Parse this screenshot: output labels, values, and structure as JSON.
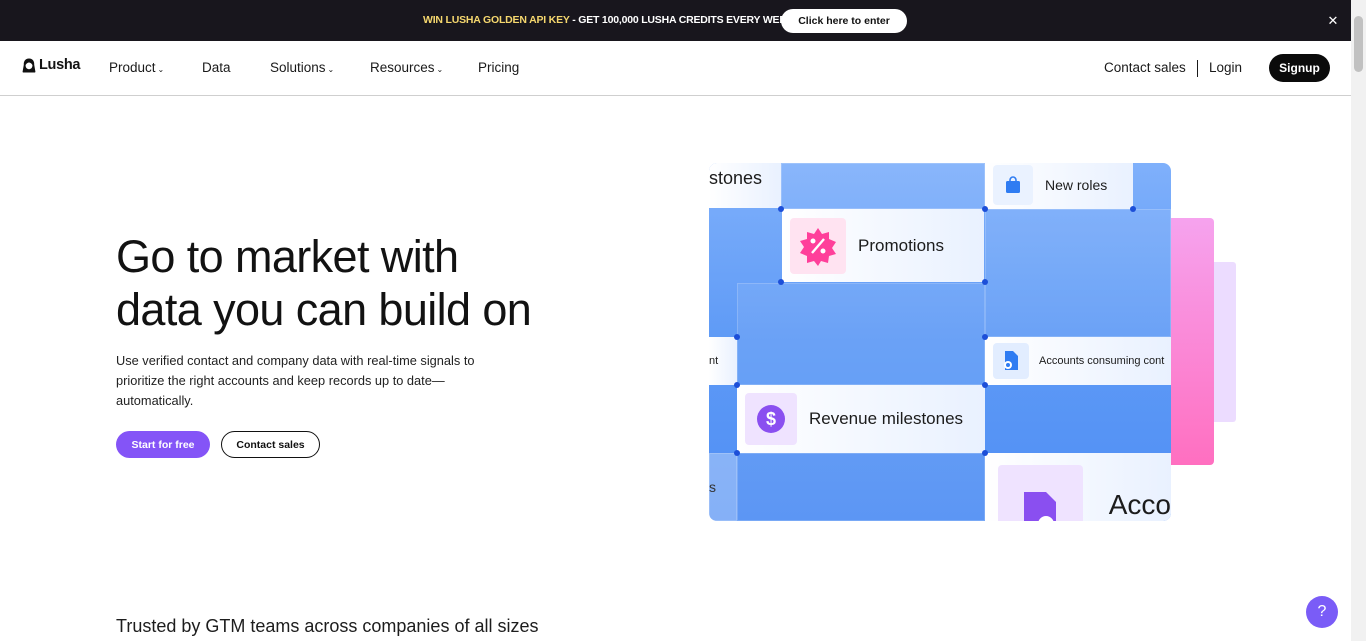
{
  "announcement": {
    "highlight": "WIN LUSHA GOLDEN API KEY",
    "text": " - GET 100,000 LUSHA CREDITS EVERY WEEK!",
    "cta": "Click here to enter",
    "close": "✕"
  },
  "nav": {
    "brand": "Lusha",
    "items": [
      {
        "label": "Product",
        "has_dropdown": true
      },
      {
        "label": "Data",
        "has_dropdown": false
      },
      {
        "label": "Solutions",
        "has_dropdown": true
      },
      {
        "label": "Resources",
        "has_dropdown": true
      },
      {
        "label": "Pricing",
        "has_dropdown": false
      }
    ],
    "contact_sales": "Contact sales",
    "login": "Login",
    "signup": "Signup"
  },
  "hero": {
    "title_line1": "Go to market with",
    "title_line2": "data you can build on",
    "subtitle": "Use verified contact and company data with real-time signals to prioritize the right accounts and keep records up to date—automatically.",
    "primary_cta": "Start for free",
    "secondary_cta": "Contact sales"
  },
  "illustration": {
    "cards": {
      "partial_top": "stones",
      "new_roles": "New roles",
      "promotions": "Promotions",
      "partial_left": "nt",
      "accounts_consuming": "Accounts consuming cont",
      "revenue": "Revenue milestones",
      "partial_bottom_left": "s",
      "accounts_bottom": "Acco"
    },
    "icons": {
      "new_roles": "shopping-bag-icon",
      "promotions": "percent-badge-icon",
      "accounts_consuming": "document-view-icon",
      "revenue": "dollar-icon",
      "accounts_bottom": "document-icon"
    },
    "colors": {
      "promotions": "#ff3f9a",
      "revenue": "#8a4ff0",
      "blue": "#2f7cf2"
    }
  },
  "trusted": "Trusted by GTM teams across companies of all sizes",
  "help": "?",
  "colors": {
    "accent": "#8454f7",
    "dark": "#18161d",
    "gold": "#f5d76e"
  }
}
